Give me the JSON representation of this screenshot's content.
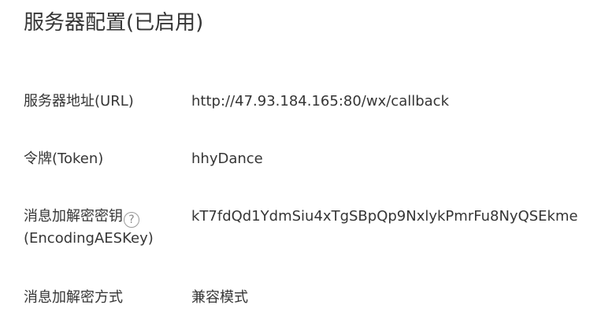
{
  "page": {
    "title": "服务器配置(已启用)"
  },
  "config": {
    "url": {
      "label": "服务器地址(URL)",
      "value": "http://47.93.184.165:80/wx/callback"
    },
    "token": {
      "label": "令牌(Token)",
      "value": "hhyDance"
    },
    "aes_key": {
      "label_line1": "消息加解密密钥",
      "label_line2": "(EncodingAESKey)",
      "help_icon": "question-circle-icon",
      "help_glyph": "?",
      "value": "kT7fdQd1YdmSiu4xTgSBpQp9NxlykPmrFu8NyQSEkme"
    },
    "encrypt_mode": {
      "label": "消息加解密方式",
      "value": "兼容模式"
    }
  }
}
